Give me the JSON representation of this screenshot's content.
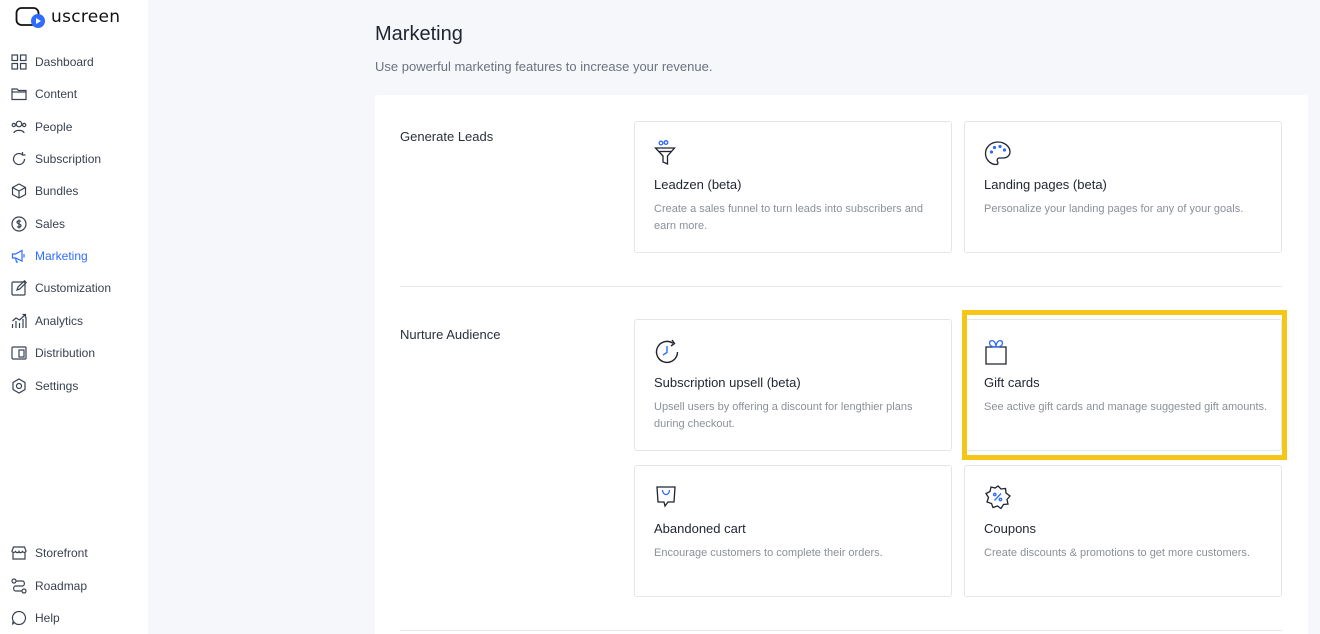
{
  "app": {
    "logo_text": "uscreen",
    "brand_color": "#2f6bff"
  },
  "sidebar": {
    "items": [
      {
        "label": "Dashboard",
        "icon": "grid-icon"
      },
      {
        "label": "Content",
        "icon": "folder-icon"
      },
      {
        "label": "People",
        "icon": "people-icon"
      },
      {
        "label": "Subscription",
        "icon": "refresh-icon"
      },
      {
        "label": "Bundles",
        "icon": "box-icon"
      },
      {
        "label": "Sales",
        "icon": "dollar-icon"
      },
      {
        "label": "Marketing",
        "icon": "megaphone-icon",
        "active": true
      },
      {
        "label": "Customization",
        "icon": "edit-icon"
      },
      {
        "label": "Analytics",
        "icon": "chart-icon"
      },
      {
        "label": "Distribution",
        "icon": "devices-icon"
      },
      {
        "label": "Settings",
        "icon": "gear-icon"
      }
    ],
    "bottom_items": [
      {
        "label": "Storefront",
        "icon": "storefront-icon"
      },
      {
        "label": "Roadmap",
        "icon": "roadmap-icon"
      },
      {
        "label": "Help",
        "icon": "help-icon"
      }
    ]
  },
  "header": {
    "title": "Marketing",
    "subtitle": "Use powerful marketing features to increase your revenue."
  },
  "sections": [
    {
      "title": "Generate Leads",
      "cards": [
        {
          "title": "Leadzen (beta)",
          "description": "Create a sales funnel to turn leads into subscribers and earn more.",
          "icon": "funnel-icon"
        },
        {
          "title": "Landing pages (beta)",
          "description": "Personalize your landing pages for any of your goals.",
          "icon": "palette-icon"
        }
      ]
    },
    {
      "title": "Nurture Audience",
      "cards": [
        {
          "title": "Subscription upsell (beta)",
          "description": "Upsell users by offering a discount for lengthier plans during checkout.",
          "icon": "clock-refresh-icon"
        },
        {
          "title": "Gift cards",
          "description": "See active gift cards and manage suggested gift amounts.",
          "icon": "gift-icon",
          "highlighted": true
        },
        {
          "title": "Abandoned cart",
          "description": "Encourage customers to complete their orders.",
          "icon": "cart-bag-icon"
        },
        {
          "title": "Coupons",
          "description": "Create discounts & promotions to get more customers.",
          "icon": "coupon-icon"
        }
      ]
    }
  ],
  "highlight_color": "#f5c518"
}
